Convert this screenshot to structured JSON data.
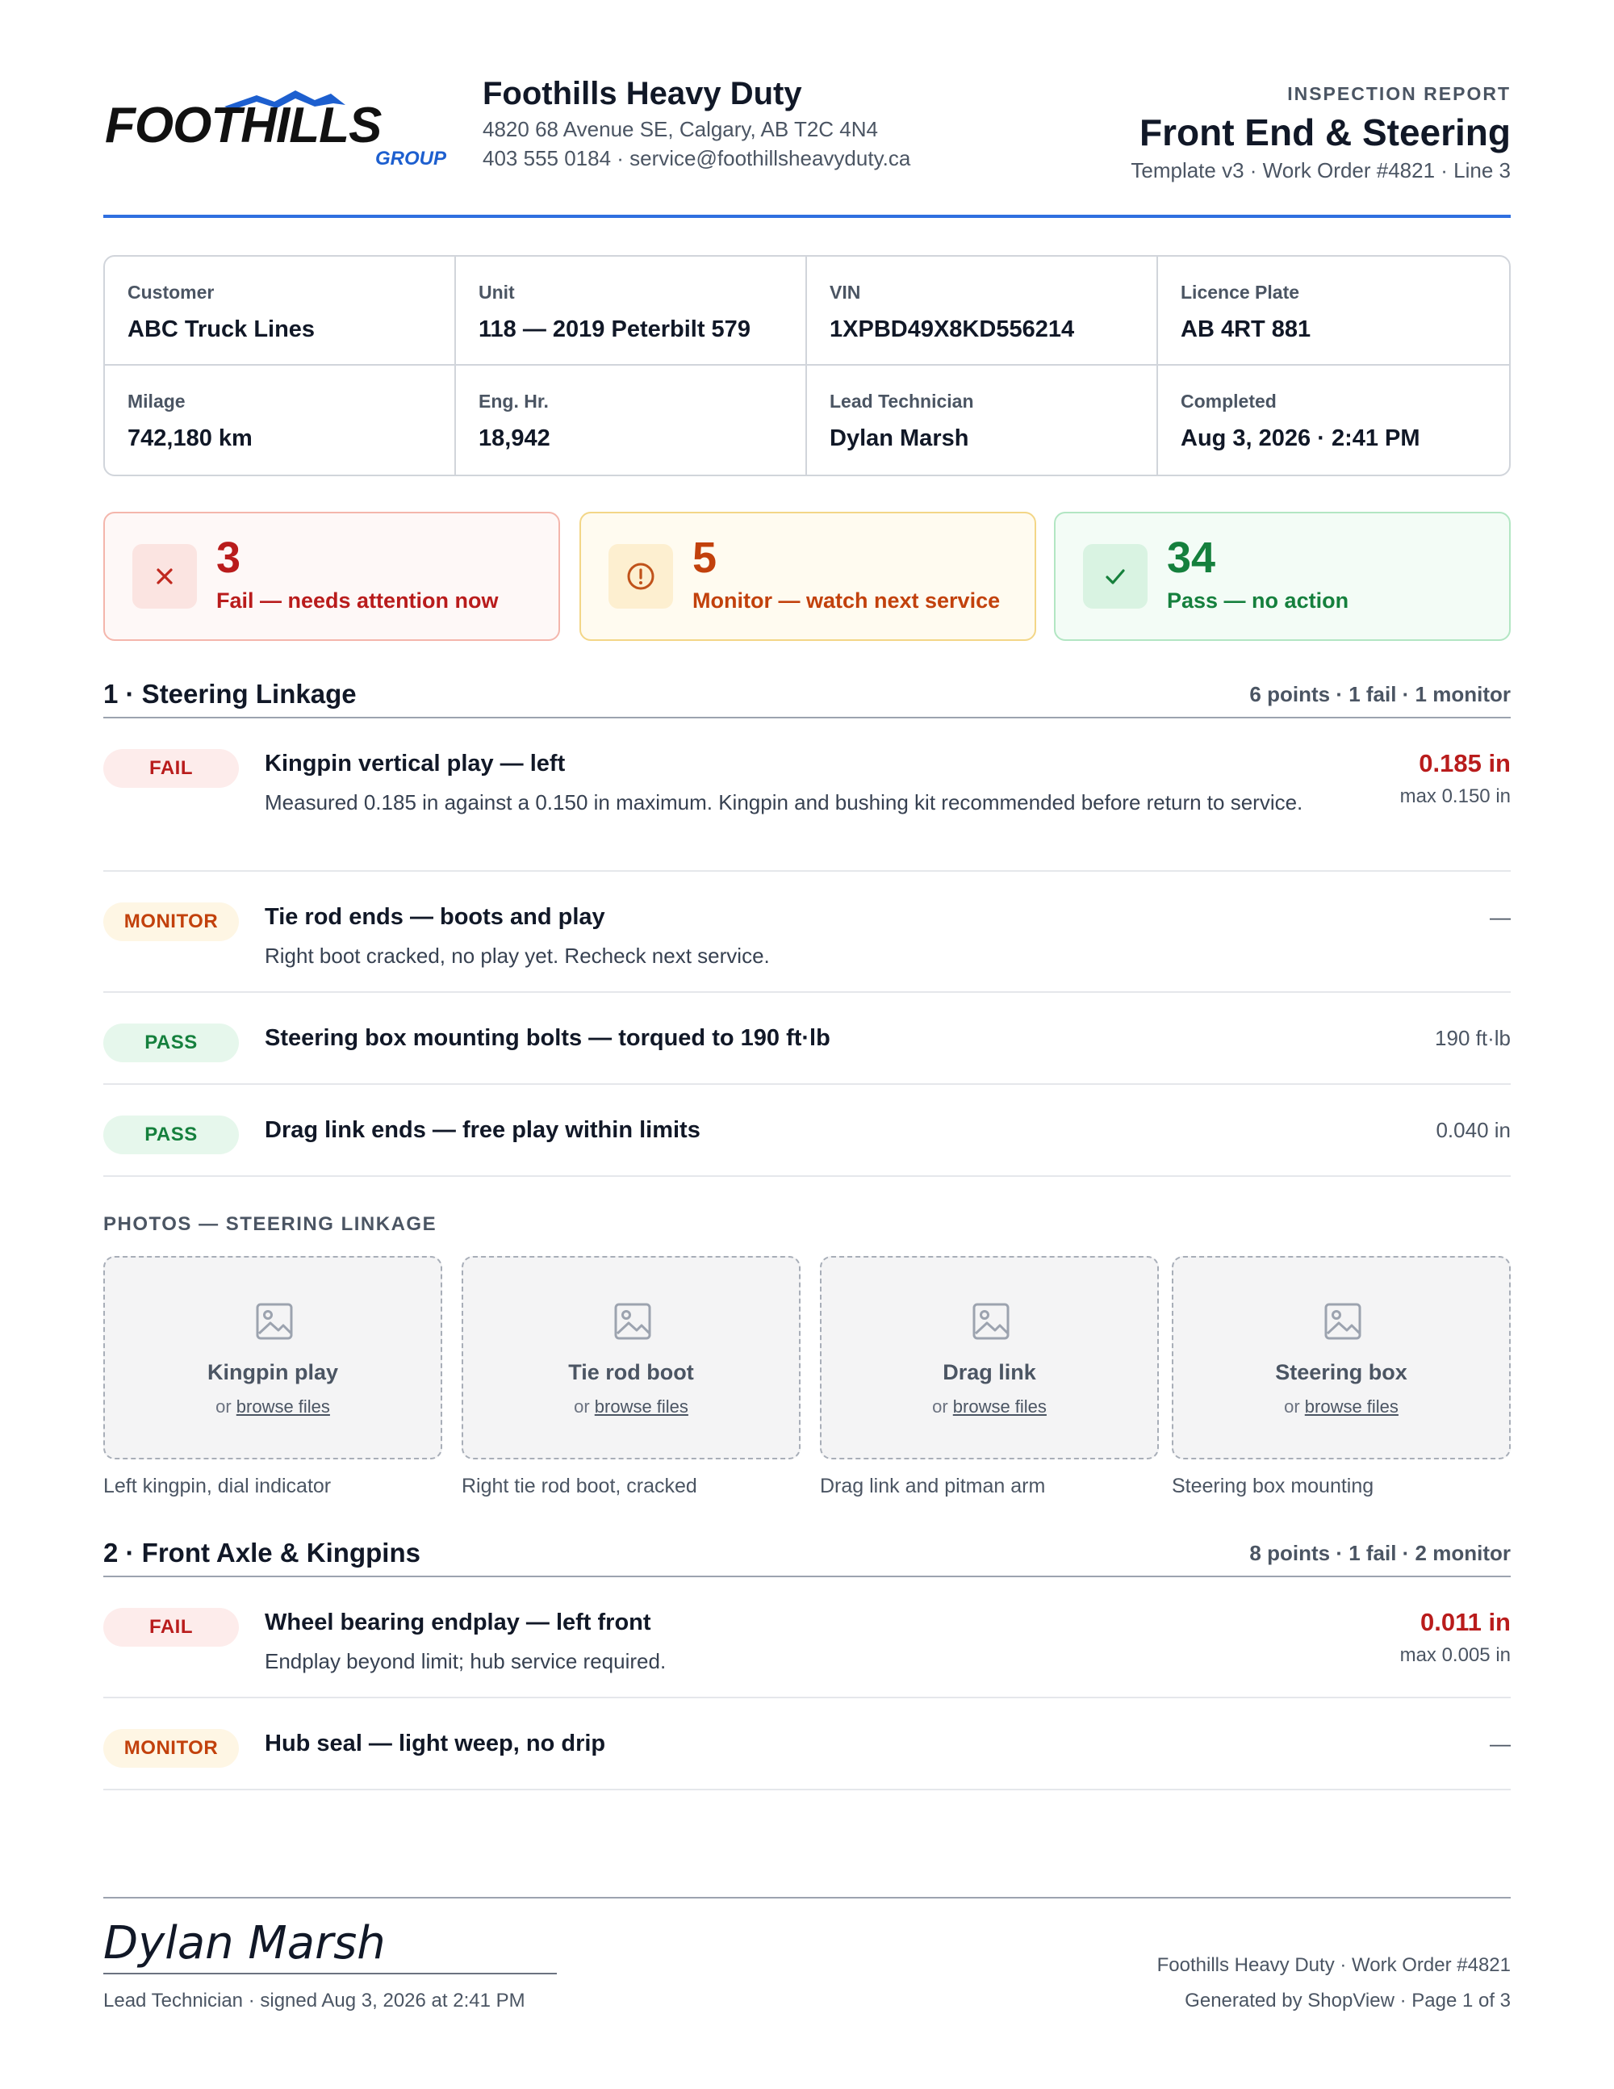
{
  "company": {
    "logo_text": "FOOTHILLS",
    "logo_sub": "GROUP",
    "name": "Foothills Heavy Duty",
    "address": "4820 68 Avenue SE, Calgary, AB T2C 4N4",
    "contact": "403 555 0184 · service@foothillsheavyduty.ca"
  },
  "report": {
    "eyebrow": "INSPECTION REPORT",
    "title": "Front End & Steering",
    "subtitle": "Template v3 · Work Order #4821 · Line 3"
  },
  "info": [
    {
      "label": "Customer",
      "value": "ABC Truck Lines"
    },
    {
      "label": "Unit",
      "value": "118 — 2019 Peterbilt 579"
    },
    {
      "label": "VIN",
      "value": "1XPBD49X8KD556214"
    },
    {
      "label": "Licence Plate",
      "value": "AB 4RT 881"
    },
    {
      "label": "Milage",
      "value": "742,180 km"
    },
    {
      "label": "Eng. Hr.",
      "value": "18,942"
    },
    {
      "label": "Lead Technician",
      "value": "Dylan Marsh"
    },
    {
      "label": "Completed",
      "value": "Aug 3, 2026 · 2:41 PM"
    }
  ],
  "summary": {
    "fail": {
      "count": "3",
      "label": "Fail — needs attention now",
      "icon": "x-icon"
    },
    "monitor": {
      "count": "5",
      "label": "Monitor — watch next service",
      "icon": "alert-circle-icon"
    },
    "pass": {
      "count": "34",
      "label": "Pass — no action",
      "icon": "check-icon"
    }
  },
  "sections": [
    {
      "title": "1 · Steering Linkage",
      "meta": "6 points · 1 fail · 1 monitor",
      "rows": [
        {
          "status": "FAIL",
          "title": "Kingpin vertical play — left",
          "desc": "Measured 0.185 in against a 0.150 in maximum. Kingpin and bushing kit recommended before return to service.",
          "value": "0.185 in",
          "max": "max 0.150 in"
        },
        {
          "status": "MONITOR",
          "title": "Tie rod ends — boots and play",
          "desc": "Right boot cracked, no play yet. Recheck next service.",
          "value": "—"
        },
        {
          "status": "PASS",
          "title": "Steering box mounting bolts — torqued to 190 ft·lb",
          "value": "190 ft·lb"
        },
        {
          "status": "PASS",
          "title": "Drag link ends — free play within limits",
          "value": "0.040 in"
        }
      ],
      "photos_title": "PHOTOS — STEERING LINKAGE",
      "photos": [
        {
          "label": "Kingpin play",
          "or": "or",
          "browse": "browse files",
          "caption": "Left kingpin, dial indicator"
        },
        {
          "label": "Tie rod boot",
          "or": "or",
          "browse": "browse files",
          "caption": "Right tie rod boot, cracked"
        },
        {
          "label": "Drag link",
          "or": "or",
          "browse": "browse files",
          "caption": "Drag link and pitman arm"
        },
        {
          "label": "Steering box",
          "or": "or",
          "browse": "browse files",
          "caption": "Steering box mounting"
        }
      ]
    },
    {
      "title": "2 · Front Axle & Kingpins",
      "meta": "8 points · 1 fail · 2 monitor",
      "rows": [
        {
          "status": "FAIL",
          "title": "Wheel bearing endplay — left front",
          "desc": "Endplay beyond limit; hub service required.",
          "value": "0.011 in",
          "max": "max 0.005 in"
        },
        {
          "status": "MONITOR",
          "title": "Hub seal — light weep, no drip",
          "value": "—"
        }
      ]
    }
  ],
  "footer": {
    "signature": "Dylan Marsh",
    "sig_caption": "Lead Technician · signed Aug 3, 2026 at 2:41 PM",
    "right_line1": "Foothills Heavy Duty · Work Order #4821",
    "right_line2": "Generated by ShopView · Page 1 of 3"
  },
  "colors": {
    "accent": "#2f6fe0",
    "logo_blue": "#1d5fcf",
    "fail": "#b91c1c",
    "monitor": "#c2410c",
    "pass": "#15803d"
  }
}
